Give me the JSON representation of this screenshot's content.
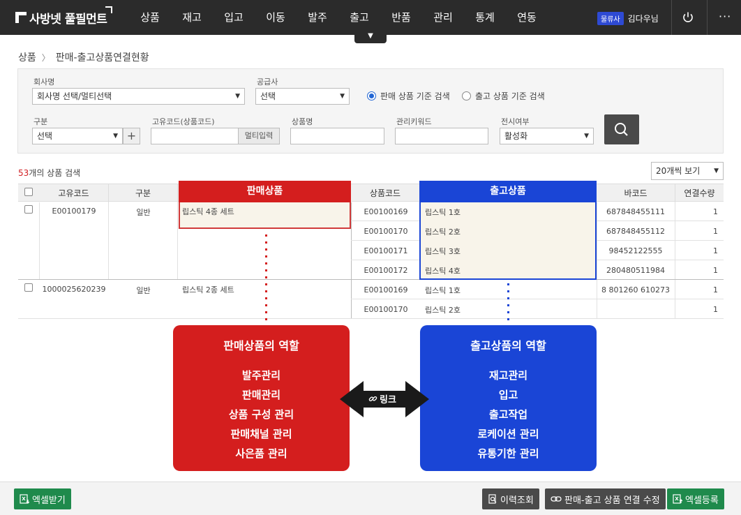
{
  "header": {
    "logo": "사방넷 풀필먼트",
    "nav": [
      "상품",
      "재고",
      "입고",
      "이동",
      "발주",
      "출고",
      "반품",
      "관리",
      "통계",
      "연동"
    ],
    "nav_toggle": "▼",
    "user_badge": "물류사",
    "user_name": "김다우님",
    "more": "···"
  },
  "breadcrumb": {
    "root": "상품",
    "current": "판매-출고상품연결현황"
  },
  "filters": {
    "company_label": "회사명",
    "company_value": "회사명 선택/멀티선택",
    "supplier_label": "공급사",
    "supplier_value": "선택",
    "radio_sales": "판매 상품 기준 검색",
    "radio_ship": "출고 상품 기준 검색",
    "type_label": "구분",
    "type_value": "선택",
    "code_label": "고유코드(상품코드)",
    "code_value": "",
    "multi_input": "멀티입력",
    "name_label": "상품명",
    "name_value": "",
    "keyword_label": "관리키워드",
    "keyword_value": "",
    "display_label": "전시여부",
    "display_value": "활성화"
  },
  "results": {
    "count": "53",
    "count_suffix": "개의 상품 검색",
    "page_size": "20개씩 보기"
  },
  "table": {
    "headers": {
      "unique_code": "고유코드",
      "type": "구분",
      "sales_product": "판매상품",
      "product_code": "상품코드",
      "ship_product": "출고상품",
      "barcode": "바코드",
      "link_qty": "연결수량"
    },
    "groups": [
      {
        "unique_code": "E00100179",
        "type": "일반",
        "sales_product": "립스틱 4종 세트",
        "items": [
          {
            "code": "E00100169",
            "name": "립스틱 1호",
            "barcode": "687848455111",
            "qty": "1"
          },
          {
            "code": "E00100170",
            "name": "립스틱 2호",
            "barcode": "687848455112",
            "qty": "1"
          },
          {
            "code": "E00100171",
            "name": "립스틱 3호",
            "barcode": "98452122555",
            "qty": "1"
          },
          {
            "code": "E00100172",
            "name": "립스틱 4호",
            "barcode": "280480511984",
            "qty": "1"
          }
        ]
      },
      {
        "unique_code": "1000025620239",
        "type": "일반",
        "sales_product": "립스틱 2종 세트",
        "items": [
          {
            "code": "E00100169",
            "name": "립스틱 1호",
            "barcode": "8 801260 610273",
            "qty": "1"
          },
          {
            "code": "E00100170",
            "name": "립스틱 2호",
            "barcode": "",
            "qty": "1"
          }
        ]
      }
    ]
  },
  "roles": {
    "sales": {
      "title": "판매상품의 역할",
      "items": [
        "발주관리",
        "판매관리",
        "상품 구성 관리",
        "판매채널 관리",
        "사은품 관리"
      ]
    },
    "ship": {
      "title": "출고상품의 역할",
      "items": [
        "재고관리",
        "입고",
        "출고작업",
        "로케이션 관리",
        "유통기한 관리"
      ]
    },
    "link_label": "링크"
  },
  "footer": {
    "excel_download": "엑셀받기",
    "history": "이력조회",
    "edit_link": "판매-출고 상품 연결 수정",
    "excel_upload": "엑셀등록"
  },
  "colors": {
    "sales": "#d41e1e",
    "ship": "#1a45d6",
    "excel": "#1f8a4c",
    "dark": "#4a4a4a"
  }
}
